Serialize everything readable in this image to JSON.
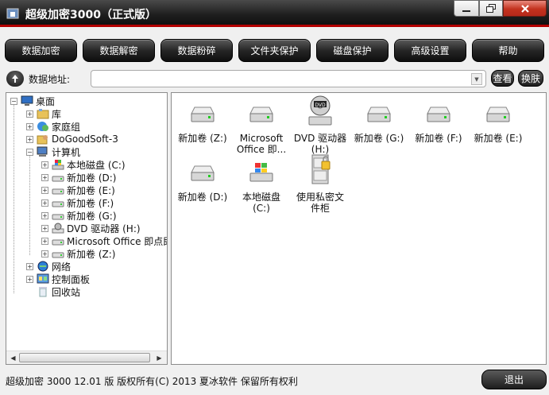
{
  "window": {
    "title": "超级加密3000（正式版）",
    "minimize_icon": "minimize-icon",
    "maximize_icon": "restore-icon",
    "close_icon": "close-icon"
  },
  "toolbar": {
    "buttons": [
      "数据加密",
      "数据解密",
      "数据粉碎",
      "文件夹保护",
      "磁盘保护",
      "高级设置",
      "帮助"
    ]
  },
  "address": {
    "label": "数据地址:",
    "value": "",
    "view_button": "查看",
    "skin_button": "换肤"
  },
  "tree": {
    "items": [
      {
        "label": "桌面",
        "icon": "desktop-icon",
        "expander": "-"
      },
      {
        "label": "库",
        "icon": "library-icon",
        "expander": "+"
      },
      {
        "label": "家庭组",
        "icon": "homegroup-icon",
        "expander": "+"
      },
      {
        "label": "DoGoodSoft-3",
        "icon": "user-folder-icon",
        "expander": "+"
      },
      {
        "label": "计算机",
        "icon": "computer-icon",
        "expander": "-"
      },
      {
        "label": "本地磁盘 (C:)",
        "icon": "windows-drive-icon",
        "expander": "+"
      },
      {
        "label": "新加卷 (D:)",
        "icon": "drive-icon",
        "expander": "+"
      },
      {
        "label": "新加卷 (E:)",
        "icon": "drive-icon",
        "expander": "+"
      },
      {
        "label": "新加卷 (F:)",
        "icon": "drive-icon",
        "expander": "+"
      },
      {
        "label": "新加卷 (G:)",
        "icon": "drive-icon",
        "expander": "+"
      },
      {
        "label": "DVD 驱动器 (H:)",
        "icon": "dvd-drive-icon",
        "expander": "+"
      },
      {
        "label": "Microsoft Office 即点即",
        "icon": "drive-icon",
        "expander": "+"
      },
      {
        "label": "新加卷 (Z:)",
        "icon": "drive-icon",
        "expander": "+"
      },
      {
        "label": "网络",
        "icon": "network-icon",
        "expander": "+"
      },
      {
        "label": "控制面板",
        "icon": "control-panel-icon",
        "expander": "+"
      },
      {
        "label": "回收站",
        "icon": "recycle-bin-icon",
        "expander": ""
      }
    ]
  },
  "content": {
    "items": [
      {
        "label": "新加卷 (Z:)",
        "icon": "drive-icon"
      },
      {
        "label": "Microsoft Office 即...",
        "icon": "drive-icon"
      },
      {
        "label": "DVD 驱动器 (H:)",
        "icon": "dvd-drive-icon"
      },
      {
        "label": "新加卷 (G:)",
        "icon": "drive-icon"
      },
      {
        "label": "新加卷 (F:)",
        "icon": "drive-icon"
      },
      {
        "label": "新加卷 (E:)",
        "icon": "drive-icon"
      },
      {
        "label": "新加卷 (D:)",
        "icon": "drive-icon"
      },
      {
        "label": "本地磁盘 (C:)",
        "icon": "windows-drive-icon"
      },
      {
        "label": "使用私密文件柜",
        "icon": "private-cabinet-icon"
      }
    ]
  },
  "status": {
    "text": "超级加密 3000  12.01 版   版权所有(C)  2013 夏冰软件   保留所有权利",
    "exit_button": "退出"
  },
  "colors": {
    "title_red_line": "#b30000",
    "button_dark": "#1d1d1d",
    "close_red": "#c3321e"
  }
}
